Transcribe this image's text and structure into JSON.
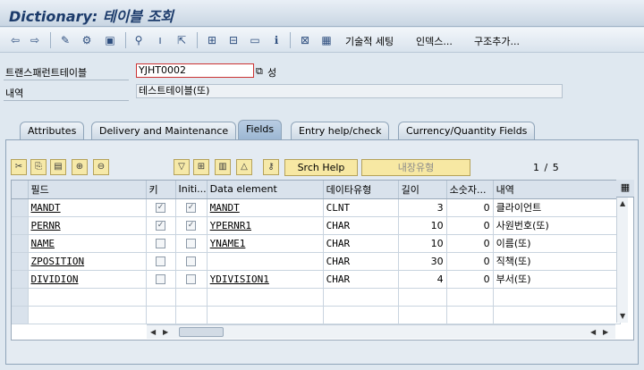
{
  "window": {
    "title": "Dictionary: 테이블 조회"
  },
  "toolbar": {
    "icons": [
      "arrow-left-icon",
      "arrow-right-icon",
      "edit-pen-icon",
      "display-change-icon",
      "other-object-icon",
      "hierarchy-icon",
      "activate-icon",
      "where-used-icon",
      "structure-icon",
      "print-icon",
      "window-icon",
      "info-icon",
      "fields-icon",
      "table-contents-icon"
    ],
    "tech_settings": "기술적 세팅",
    "indexes": "인덱스...",
    "append_structure": "구조추가..."
  },
  "header": {
    "table_label": "트랜스패런트테이블",
    "table_value": "YJHT0002",
    "status": "성",
    "desc_label": "내역",
    "desc_value": "테스트테이블(또)"
  },
  "tabs": [
    {
      "label": "Attributes"
    },
    {
      "label": "Delivery and Maintenance"
    },
    {
      "label": "Fields"
    },
    {
      "label": "Entry help/check"
    },
    {
      "label": "Currency/Quantity Fields"
    }
  ],
  "grid_toolbar": {
    "srch_help": "Srch Help",
    "builtin_type": "내장유형",
    "page_current": "1",
    "page_sep": "/",
    "page_total": "5"
  },
  "table": {
    "columns": [
      "필드",
      "키",
      "Initi...",
      "Data element",
      "데이타유형",
      "길이",
      "소숫자...",
      "내역"
    ],
    "rows": [
      {
        "field": "MANDT",
        "key": true,
        "init": true,
        "element": "MANDT",
        "type": "CLNT",
        "length": "3",
        "decimals": "0",
        "desc": "클라이언트"
      },
      {
        "field": "PERNR",
        "key": true,
        "init": true,
        "element": "YPERNR1",
        "type": "CHAR",
        "length": "10",
        "decimals": "0",
        "desc": "사원번호(또)"
      },
      {
        "field": "NAME",
        "key": false,
        "init": false,
        "element": "YNAME1",
        "type": "CHAR",
        "length": "10",
        "decimals": "0",
        "desc": "이름(또)"
      },
      {
        "field": "ZPOSITION",
        "key": false,
        "init": false,
        "element": "",
        "type": "CHAR",
        "length": "30",
        "decimals": "0",
        "desc": "직책(또)"
      },
      {
        "field": "DIVIDION",
        "key": false,
        "init": false,
        "element": "YDIVISION1",
        "type": "CHAR",
        "length": "4",
        "decimals": "0",
        "desc": "부서(또)"
      }
    ]
  }
}
